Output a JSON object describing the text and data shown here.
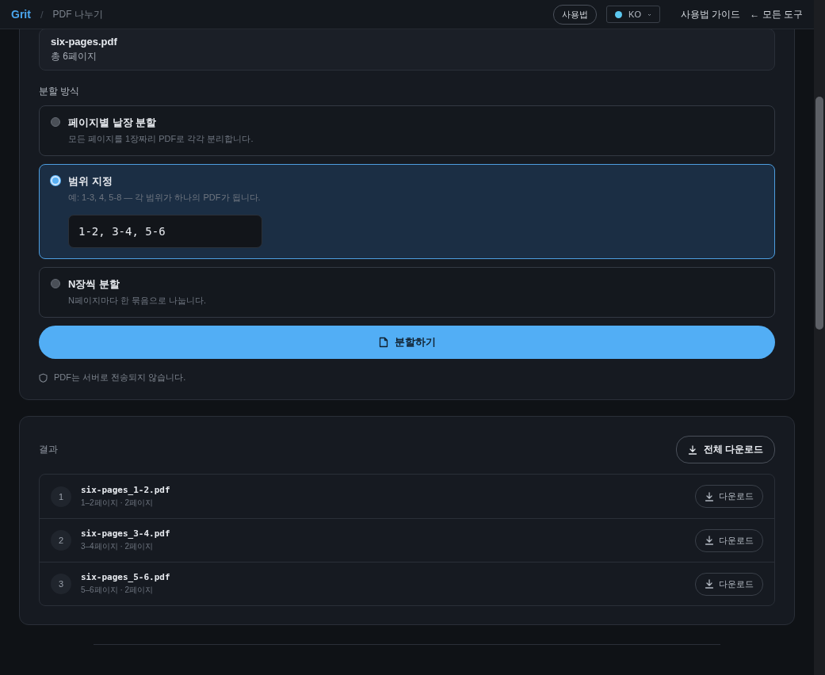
{
  "header": {
    "brand": "Grit",
    "separator": "/",
    "page_title": "PDF 나누기",
    "help_button": "사용법",
    "language": "KO",
    "guide_link": "사용법 가이드",
    "back_link": "← 모든 도구"
  },
  "file": {
    "name": "six-pages.pdf",
    "pages": "총 6페이지"
  },
  "split_mode": {
    "label": "분할 방식",
    "options": [
      {
        "title": "페이지별 낱장 분할",
        "description": "모든 페이지를 1장짜리 PDF로 각각 분리합니다.",
        "selected": false
      },
      {
        "title": "범위 지정",
        "description": "예: 1-3, 4, 5-8 — 각 범위가 하나의 PDF가 됩니다.",
        "selected": true,
        "range_value": "1-2, 3-4, 5-6"
      },
      {
        "title": "N장씩 분할",
        "description": "N페이지마다 한 묶음으로 나눕니다.",
        "selected": false
      }
    ]
  },
  "split_button": "분할하기",
  "privacy_note": "PDF는 서버로 전송되지 않습니다.",
  "results": {
    "title": "결과",
    "download_all": "전체 다운로드",
    "files": [
      {
        "index": "1",
        "name": "six-pages_1-2.pdf",
        "detail": "1–2페이지 · 2페이지",
        "download": "다운로드"
      },
      {
        "index": "2",
        "name": "six-pages_3-4.pdf",
        "detail": "3–4페이지 · 2페이지",
        "download": "다운로드"
      },
      {
        "index": "3",
        "name": "six-pages_5-6.pdf",
        "detail": "5–6페이지 · 2페이지",
        "download": "다운로드"
      }
    ]
  }
}
